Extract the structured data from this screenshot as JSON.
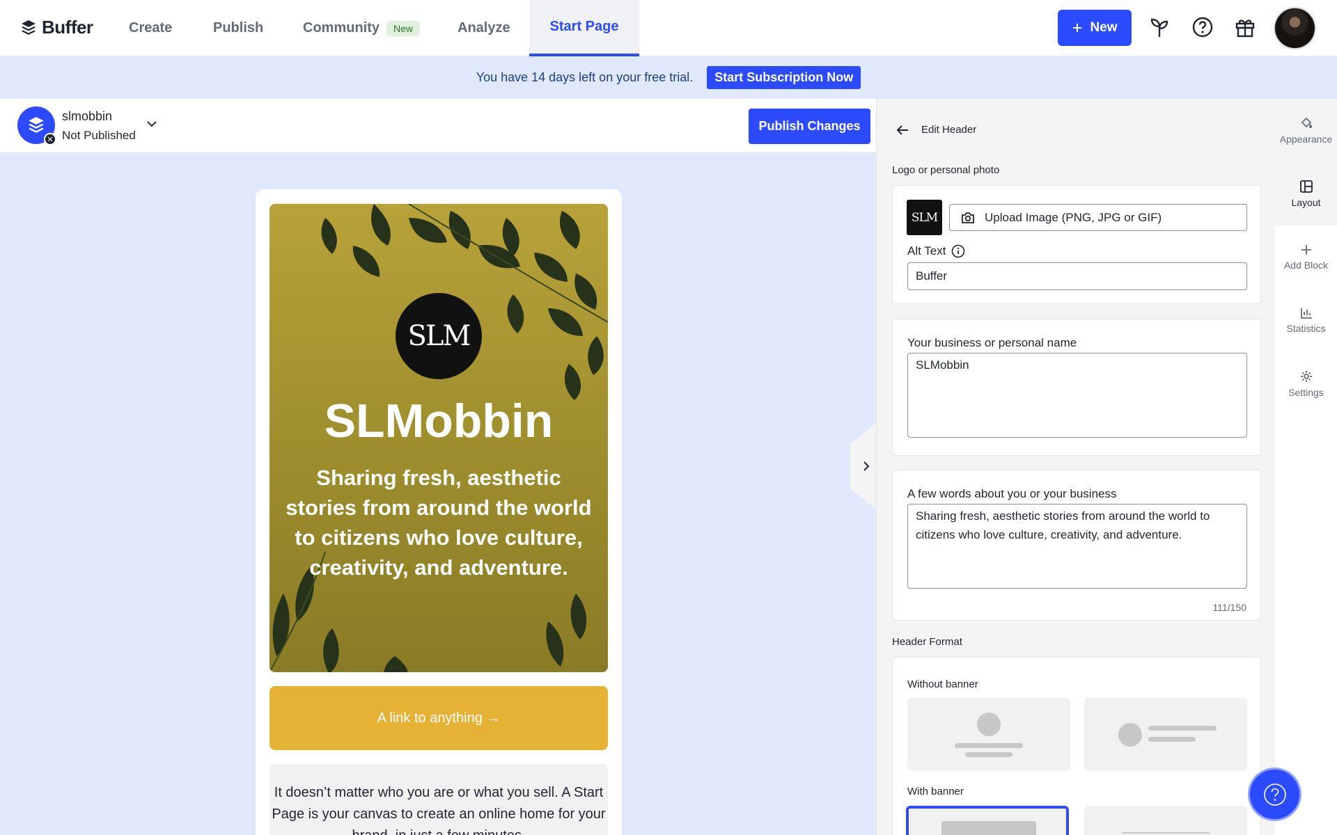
{
  "brand": {
    "name": "Buffer"
  },
  "nav": {
    "create": "Create",
    "publish": "Publish",
    "community": "Community",
    "community_badge": "New",
    "analyze": "Analyze",
    "start_page": "Start Page",
    "new_button": "New"
  },
  "trial": {
    "message": "You have 14 days left on your free trial.",
    "cta": "Start Subscription Now"
  },
  "page": {
    "name": "slmobbin",
    "status": "Not Published",
    "publish_button": "Publish Changes"
  },
  "preview": {
    "logo_text": "SLM",
    "title": "SLMobbin",
    "description": "Sharing fresh, aesthetic stories from around the world to citizens who love culture, creativity, and adventure.",
    "link_label": "A link to anything →",
    "text_block": "It doesn’t matter who you are or what you sell. A Start Page is your canvas to create an online home for your brand, in just a few minutes."
  },
  "panel": {
    "title": "Edit Header",
    "logo_section": "Logo or personal photo",
    "logo_thumb": "SLM",
    "upload_label": "Upload Image (PNG, JPG or GIF)",
    "alt_text_label": "Alt Text",
    "alt_text_value": "Buffer",
    "name_label": "Your business or personal name",
    "name_value": "SLMobbin",
    "about_label": "A few words about you or your business",
    "about_value": "Sharing fresh, aesthetic stories from around the world to citizens who love culture, creativity, and adventure.",
    "about_counter": "111/150",
    "format_section": "Header Format",
    "without_banner": "Without banner",
    "with_banner": "With banner"
  },
  "rail": {
    "appearance": "Appearance",
    "layout": "Layout",
    "add_block": "Add Block",
    "statistics": "Statistics",
    "settings": "Settings"
  },
  "colors": {
    "accent": "#2c4bff",
    "banner_bg": "#e0e8fb",
    "link_block": "#e5b236",
    "hero_bg": "#a1912e"
  }
}
